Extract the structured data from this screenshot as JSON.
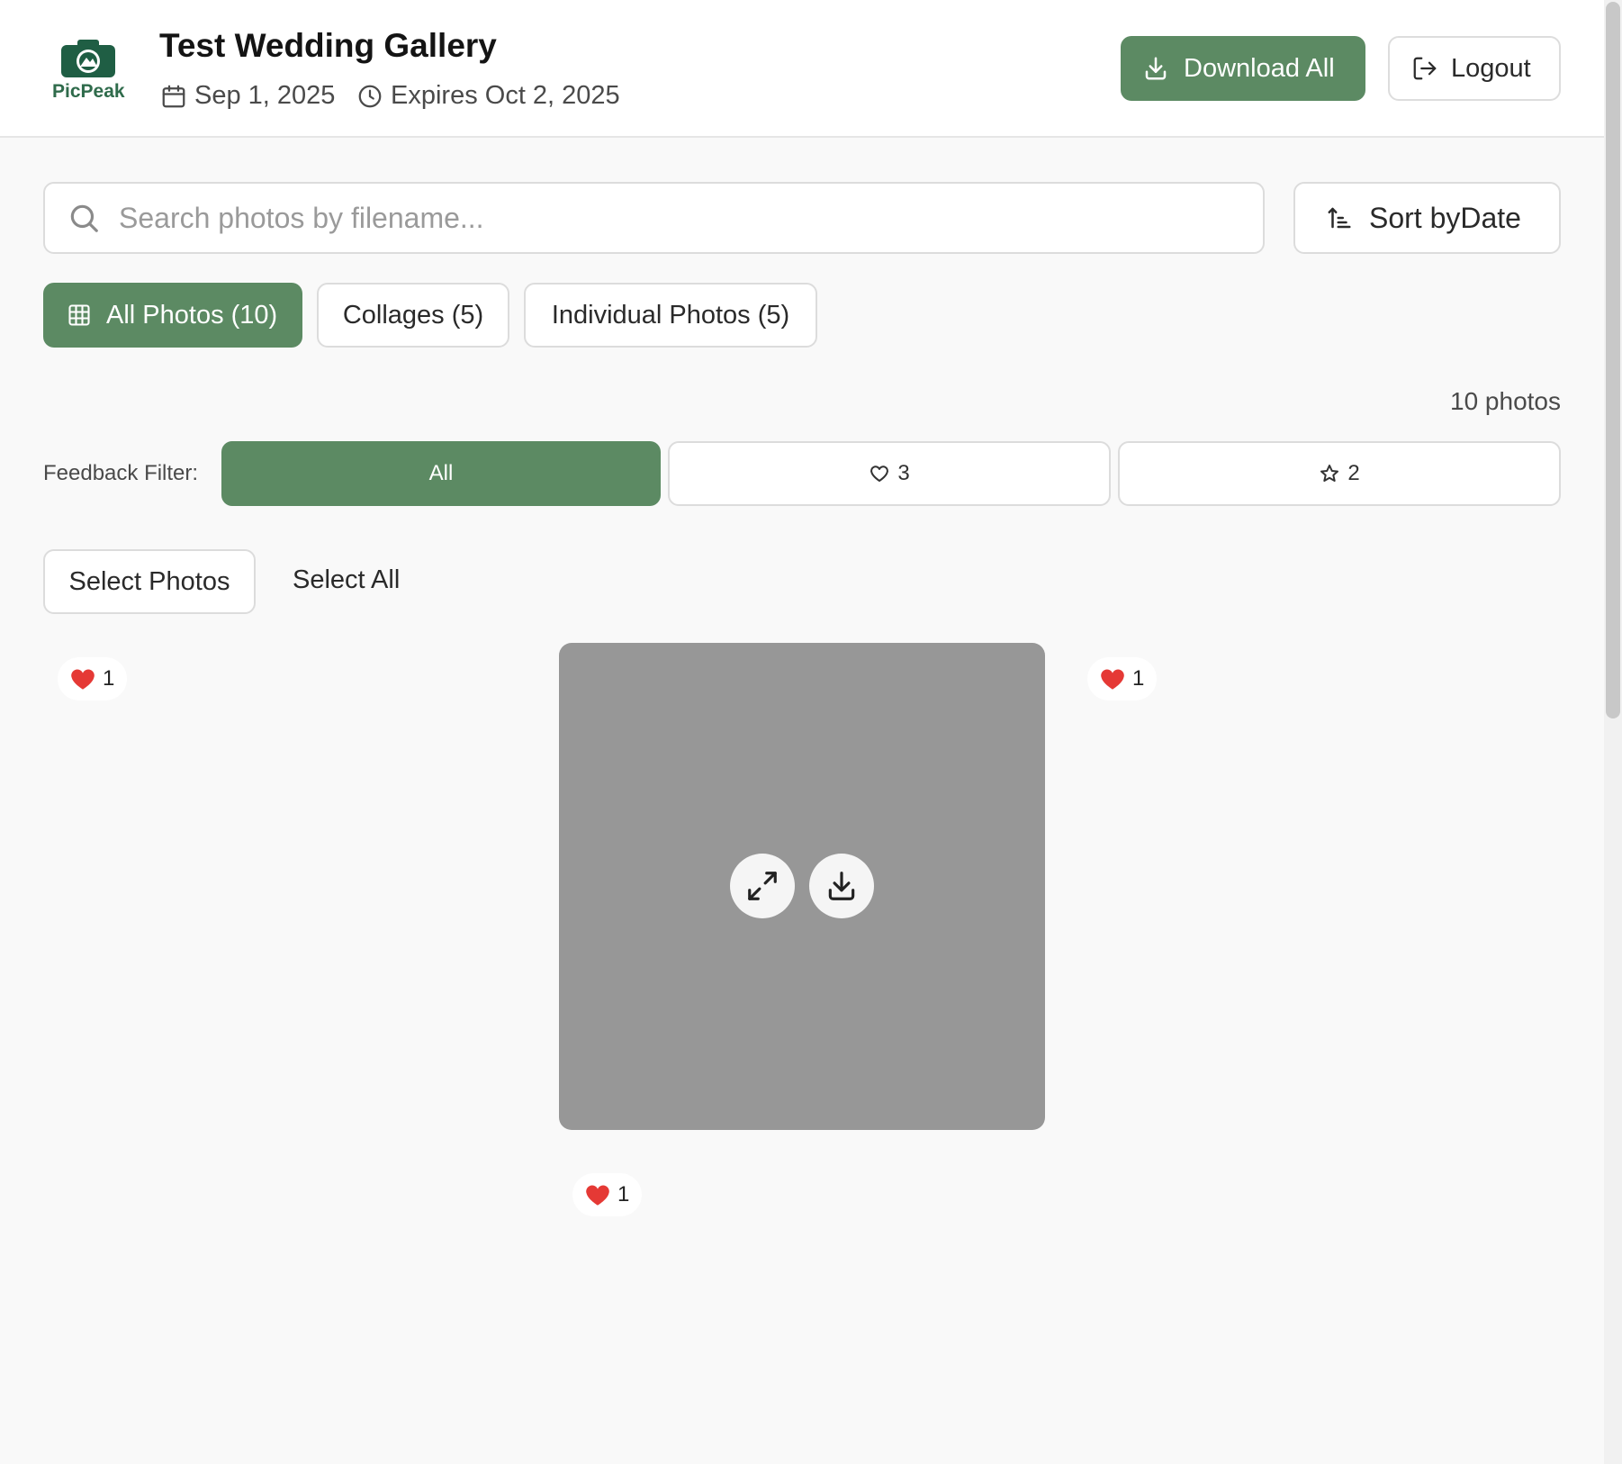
{
  "header": {
    "logo_text": "PicPeak",
    "title": "Test Wedding Gallery",
    "date": "Sep 1, 2025",
    "expires": "Expires Oct 2, 2025",
    "download_all_label": "Download All",
    "logout_label": "Logout"
  },
  "search": {
    "placeholder": "Search photos by filename...",
    "value": ""
  },
  "sort": {
    "label": "Sort byDate"
  },
  "tabs": [
    {
      "label": "All Photos (10)",
      "active": true
    },
    {
      "label": "Collages (5)",
      "active": false
    },
    {
      "label": "Individual Photos (5)",
      "active": false
    }
  ],
  "photo_count": "10 photos",
  "feedback_filter": {
    "label": "Feedback Filter:",
    "all_label": "All",
    "likes_count": "3",
    "favorites_count": "2"
  },
  "selection": {
    "select_photos_label": "Select Photos",
    "select_all_label": "Select All"
  },
  "gallery": {
    "likes": [
      "1",
      "1",
      "1"
    ]
  },
  "colors": {
    "accent": "#5c8a63",
    "heart": "#e53935",
    "logo": "#1f5e44"
  },
  "icons": {
    "logo": "camera-mountain-icon",
    "date": "calendar-icon",
    "expires": "clock-icon",
    "download": "download-icon",
    "logout": "logout-icon",
    "search": "search-icon",
    "sort": "sort-ascending-icon",
    "grid": "grid-icon",
    "heart": "heart-icon",
    "star": "star-icon",
    "expand": "expand-icon"
  }
}
